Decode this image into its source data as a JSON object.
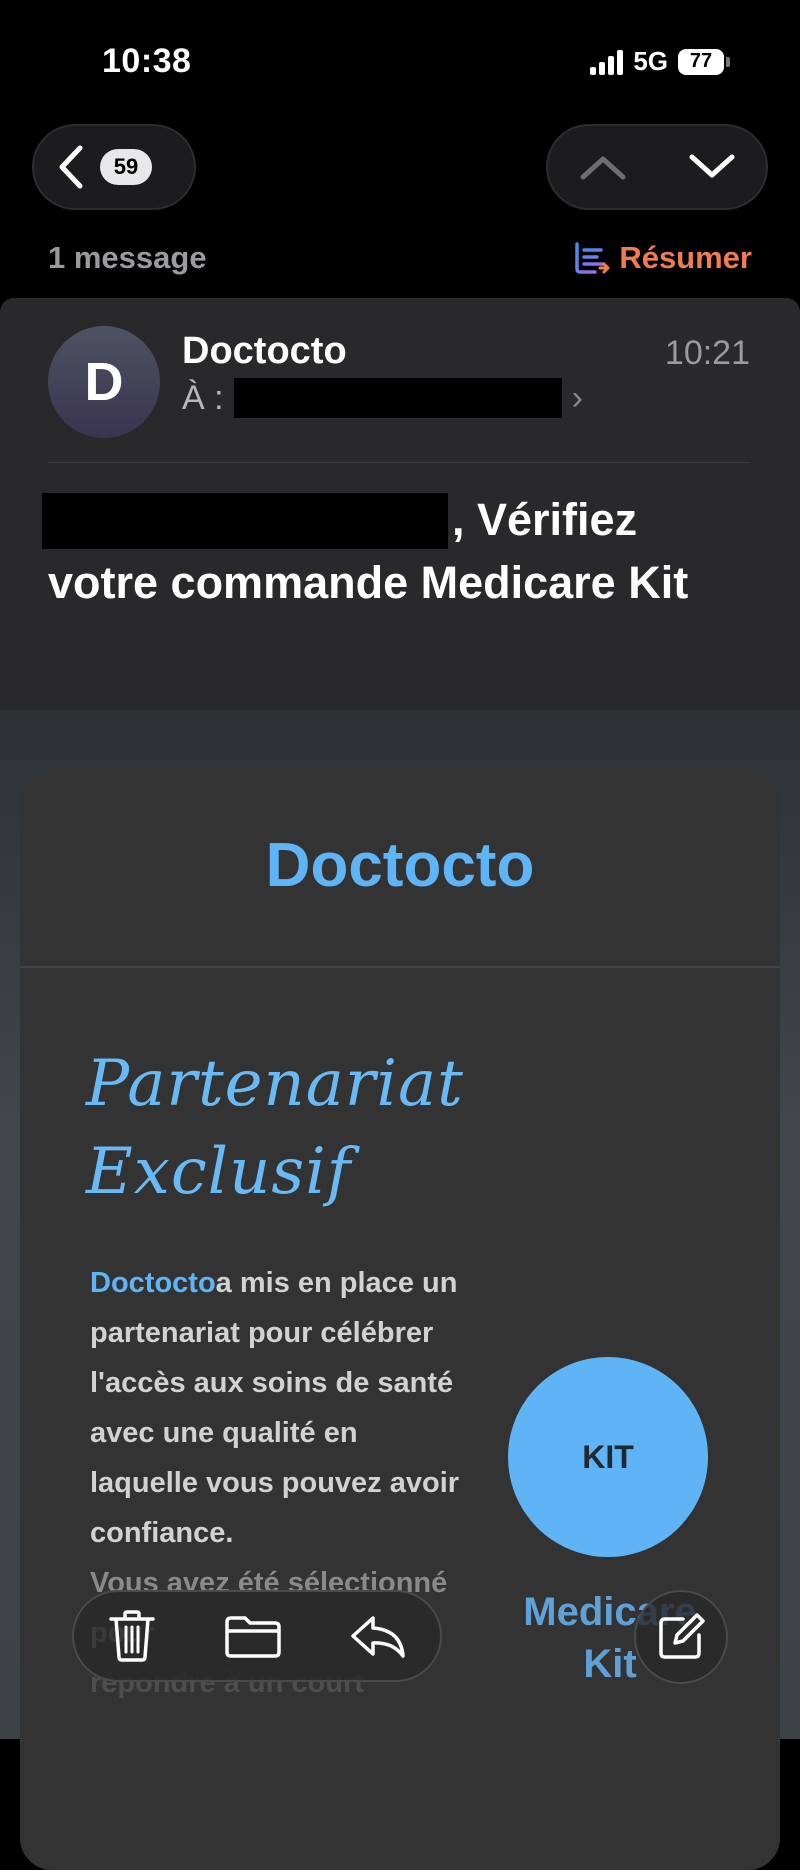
{
  "status_bar": {
    "time": "10:38",
    "network": "5G",
    "battery": "77"
  },
  "nav": {
    "unread_count": "59"
  },
  "thread": {
    "message_count": "1 message",
    "summarize_label": "Résumer"
  },
  "email": {
    "avatar_letter": "D",
    "sender": "Doctocto",
    "to_label": "À :",
    "time": "10:21",
    "subject_rest": ", Vérifiez votre commande Medicare Kit"
  },
  "body": {
    "brand": "Doctocto",
    "headline_line1": "Partenariat",
    "headline_line2": "Exclusif",
    "intro_brand": "Doctocto",
    "intro_text": "a mis en place un partenariat pour célébrer l'accès aux soins de santé avec une qualité en laquelle vous pouvez avoir confiance.",
    "intro_continued": "Vous avez été sélectionné pour",
    "intro_faded": "répondre à un court",
    "kit_badge": "KIT",
    "kit_label": "Medicare Kit"
  },
  "colors": {
    "accent": "#5fb4f6",
    "summarize": "#ef7d4f",
    "background": "#000000"
  },
  "icons": [
    "back-chevron-icon",
    "up-chevron-icon",
    "down-chevron-icon",
    "summarize-icon",
    "trash-icon",
    "folder-icon",
    "reply-icon",
    "compose-icon"
  ]
}
